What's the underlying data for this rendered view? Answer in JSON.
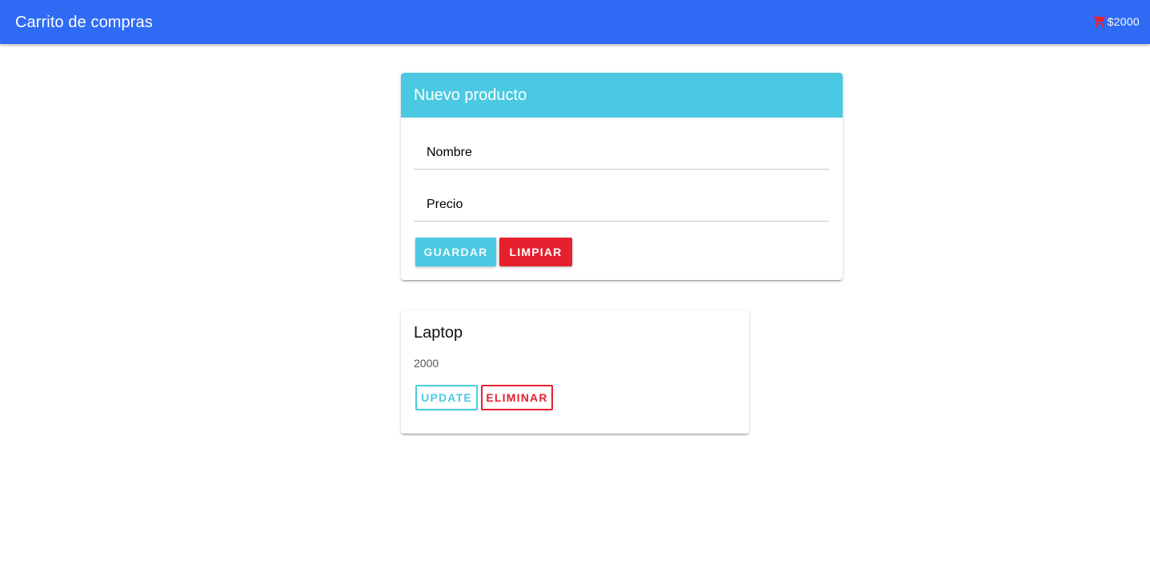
{
  "appbar": {
    "title": "Carrito de compras",
    "cart_icon": "cart-icon",
    "cart_total": "$2000"
  },
  "form": {
    "header": "Nuevo producto",
    "name_placeholder": "Nombre",
    "name_value": "",
    "price_placeholder": "Precio",
    "price_value": "",
    "save_label": "GUARDAR",
    "clear_label": "LIMPIAR"
  },
  "products": [
    {
      "name": "Laptop",
      "price": "2000",
      "update_label": "UPDATE",
      "delete_label": "ELIMINAR"
    }
  ],
  "colors": {
    "appbar": "#2f6bf5",
    "accent": "#4bc9e2",
    "danger": "#e5212f"
  }
}
